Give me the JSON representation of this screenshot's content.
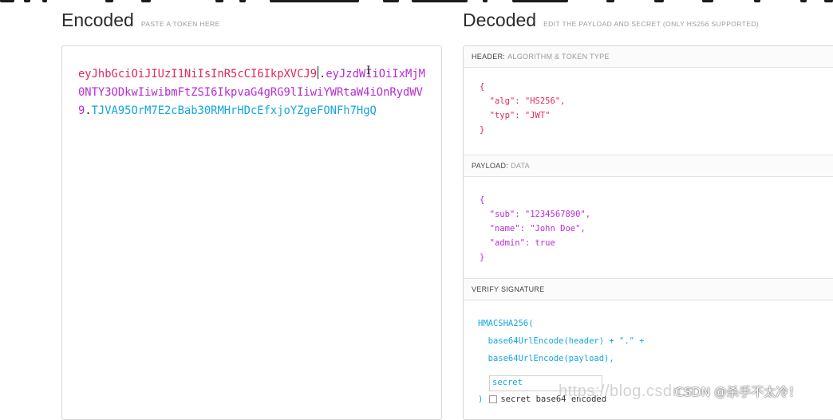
{
  "encoded": {
    "title": "Encoded",
    "hint": "PASTE A TOKEN HERE",
    "token_header": "eyJhbGciOiJIUzI1NiIsInR5cCI6IkpXVCJ9",
    "token_payload": "eyJzdWIiOiIxMjM0NTY3ODkwIiwibmFtZSI6IkpvaG4gRG9lIiwiYWRtaW4iOnRydWV9",
    "token_signature": "TJVA95OrM7E2cBab30RMHrHDcEfxjoYZgeFONFh7HgQ",
    "dot": "."
  },
  "decoded": {
    "title": "Decoded",
    "hint": "EDIT THE PAYLOAD AND SECRET (ONLY HS256 SUPPORTED)",
    "header_section": {
      "label": "HEADER:",
      "sublabel": "ALGORITHM & TOKEN TYPE",
      "lines": [
        "{",
        "  \"alg\": \"HS256\",",
        "  \"typ\": \"JWT\"",
        "}"
      ]
    },
    "payload_section": {
      "label": "PAYLOAD:",
      "sublabel": "DATA",
      "lines": [
        "{",
        "  \"sub\": \"1234567890\",",
        "  \"name\": \"John Doe\",",
        "  \"admin\": true",
        "}"
      ]
    },
    "signature_section": {
      "label": "VERIFY SIGNATURE",
      "lines": [
        "HMACSHA256(",
        "  base64UrlEncode(header) + \".\" +",
        "  base64UrlEncode(payload),"
      ],
      "secret_value": "secret",
      "close_paren": ")",
      "base64_label": "secret base64 encoded"
    }
  },
  "watermark": {
    "url_fragment": "https://blog.csdn.n",
    "csdn_label": "CSDN @杀手不太冷！"
  },
  "colors": {
    "header": "#e0295d",
    "payload": "#b62bd4",
    "signature": "#14a6df"
  }
}
